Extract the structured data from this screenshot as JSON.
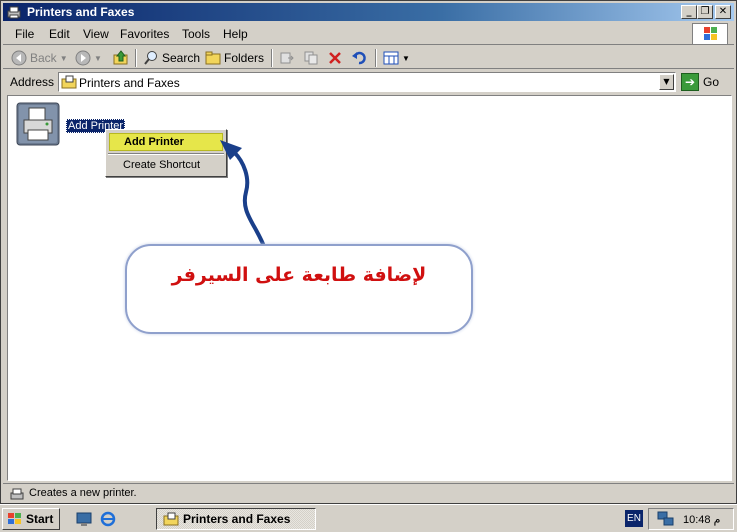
{
  "window": {
    "title": "Printers and Faxes",
    "buttons": {
      "minimize": "_",
      "restore": "❐",
      "close": "✕"
    }
  },
  "menubar": {
    "items": [
      {
        "label": "File"
      },
      {
        "label": "Edit"
      },
      {
        "label": "View"
      },
      {
        "label": "Favorites"
      },
      {
        "label": "Tools"
      },
      {
        "label": "Help"
      }
    ]
  },
  "toolbar": {
    "back_label": "Back",
    "search_label": "Search",
    "folders_label": "Folders"
  },
  "address": {
    "label": "Address",
    "value": "Printers and Faxes",
    "go_label": "Go"
  },
  "content": {
    "item_label": "Add Printer",
    "context_menu": {
      "items": [
        {
          "label": "Add Printer"
        },
        {
          "label": "Create Shortcut"
        }
      ]
    },
    "annotation_text": "لإضافة طابعة على السيرفر"
  },
  "status": {
    "text": "Creates a new printer."
  },
  "taskbar": {
    "start_label": "Start",
    "task_label": "Printers and Faxes",
    "lang": "EN",
    "clock": "10:48 م"
  },
  "colors": {
    "titlebar": "#0a246a",
    "highlight": "#e6e64a",
    "annotation_text": "#d01010",
    "arrow": "#1a3f8a"
  }
}
